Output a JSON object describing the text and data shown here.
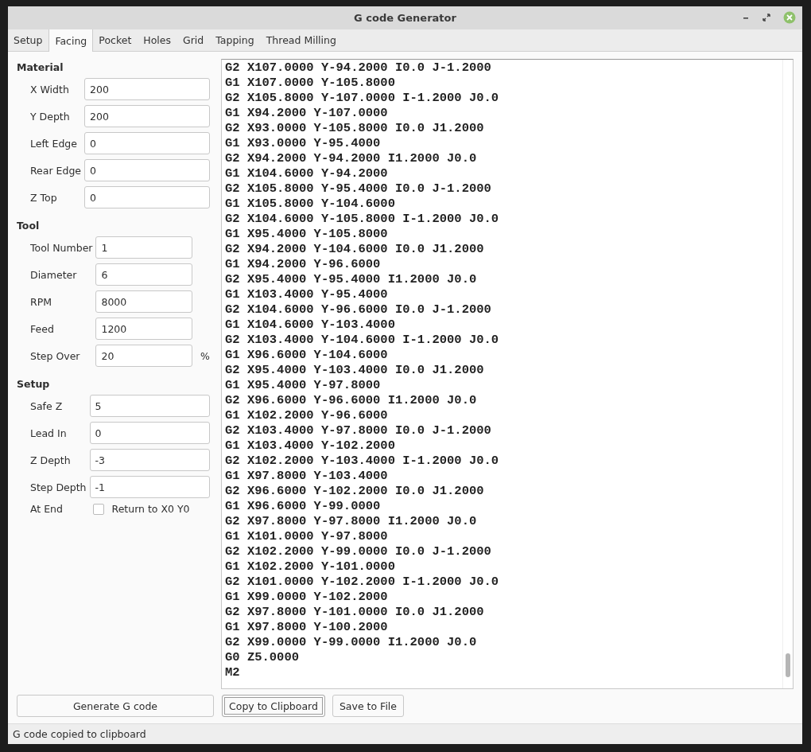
{
  "window": {
    "title": "G code Generator"
  },
  "tabs": [
    {
      "label": "Setup",
      "selected": false
    },
    {
      "label": "Facing",
      "selected": true
    },
    {
      "label": "Pocket",
      "selected": false
    },
    {
      "label": "Holes",
      "selected": false
    },
    {
      "label": "Grid",
      "selected": false
    },
    {
      "label": "Tapping",
      "selected": false
    },
    {
      "label": "Thread Milling",
      "selected": false
    }
  ],
  "sections": [
    {
      "title": "Material",
      "fields": [
        {
          "kind": "text",
          "label": "X Width",
          "value": "200"
        },
        {
          "kind": "text",
          "label": "Y Depth",
          "value": "200"
        },
        {
          "kind": "text",
          "label": "Left Edge",
          "value": "0"
        },
        {
          "kind": "text",
          "label": "Rear Edge",
          "value": "0"
        },
        {
          "kind": "text",
          "label": "Z Top",
          "value": "0"
        }
      ]
    },
    {
      "title": "Tool",
      "fields": [
        {
          "kind": "text",
          "label": "Tool Number",
          "value": "1"
        },
        {
          "kind": "text",
          "label": "Diameter",
          "value": "6"
        },
        {
          "kind": "text",
          "label": "RPM",
          "value": "8000"
        },
        {
          "kind": "text",
          "label": "Feed",
          "value": "1200"
        },
        {
          "kind": "text",
          "label": "Step Over",
          "value": "20",
          "suffix": "%"
        }
      ]
    },
    {
      "title": "Setup",
      "fields": [
        {
          "kind": "text",
          "label": "Safe Z",
          "value": "5"
        },
        {
          "kind": "text",
          "label": "Lead In",
          "value": "0"
        },
        {
          "kind": "text",
          "label": "Z Depth",
          "value": "-3"
        },
        {
          "kind": "text",
          "label": "Step Depth",
          "value": "-1"
        },
        {
          "kind": "checkbox",
          "label": "At End",
          "option": "Return to X0 Y0",
          "checked": false
        }
      ]
    }
  ],
  "code_lines": [
    "G2 X107.0000 Y-94.2000 I0.0 J-1.2000",
    "G1 X107.0000 Y-105.8000",
    "G2 X105.8000 Y-107.0000 I-1.2000 J0.0",
    "G1 X94.2000 Y-107.0000",
    "G2 X93.0000 Y-105.8000 I0.0 J1.2000",
    "G1 X93.0000 Y-95.4000",
    "G2 X94.2000 Y-94.2000 I1.2000 J0.0",
    "G1 X104.6000 Y-94.2000",
    "G2 X105.8000 Y-95.4000 I0.0 J-1.2000",
    "G1 X105.8000 Y-104.6000",
    "G2 X104.6000 Y-105.8000 I-1.2000 J0.0",
    "G1 X95.4000 Y-105.8000",
    "G2 X94.2000 Y-104.6000 I0.0 J1.2000",
    "G1 X94.2000 Y-96.6000",
    "G2 X95.4000 Y-95.4000 I1.2000 J0.0",
    "G1 X103.4000 Y-95.4000",
    "G2 X104.6000 Y-96.6000 I0.0 J-1.2000",
    "G1 X104.6000 Y-103.4000",
    "G2 X103.4000 Y-104.6000 I-1.2000 J0.0",
    "G1 X96.6000 Y-104.6000",
    "G2 X95.4000 Y-103.4000 I0.0 J1.2000",
    "G1 X95.4000 Y-97.8000",
    "G2 X96.6000 Y-96.6000 I1.2000 J0.0",
    "G1 X102.2000 Y-96.6000",
    "G2 X103.4000 Y-97.8000 I0.0 J-1.2000",
    "G1 X103.4000 Y-102.2000",
    "G2 X102.2000 Y-103.4000 I-1.2000 J0.0",
    "G1 X97.8000 Y-103.4000",
    "G2 X96.6000 Y-102.2000 I0.0 J1.2000",
    "G1 X96.6000 Y-99.0000",
    "G2 X97.8000 Y-97.8000 I1.2000 J0.0",
    "G1 X101.0000 Y-97.8000",
    "G2 X102.2000 Y-99.0000 I0.0 J-1.2000",
    "G1 X102.2000 Y-101.0000",
    "G2 X101.0000 Y-102.2000 I-1.2000 J0.0",
    "G1 X99.0000 Y-102.2000",
    "G2 X97.8000 Y-101.0000 I0.0 J1.2000",
    "G1 X97.8000 Y-100.2000",
    "G2 X99.0000 Y-99.0000 I1.2000 J0.0",
    "G0 Z5.0000",
    "M2"
  ],
  "buttons": [
    {
      "label": "Generate G code",
      "focused": false
    },
    {
      "label": "Copy to Clipboard",
      "focused": true
    },
    {
      "label": "Save to File",
      "focused": false
    }
  ],
  "status_bar": "G code copied to clipboard"
}
